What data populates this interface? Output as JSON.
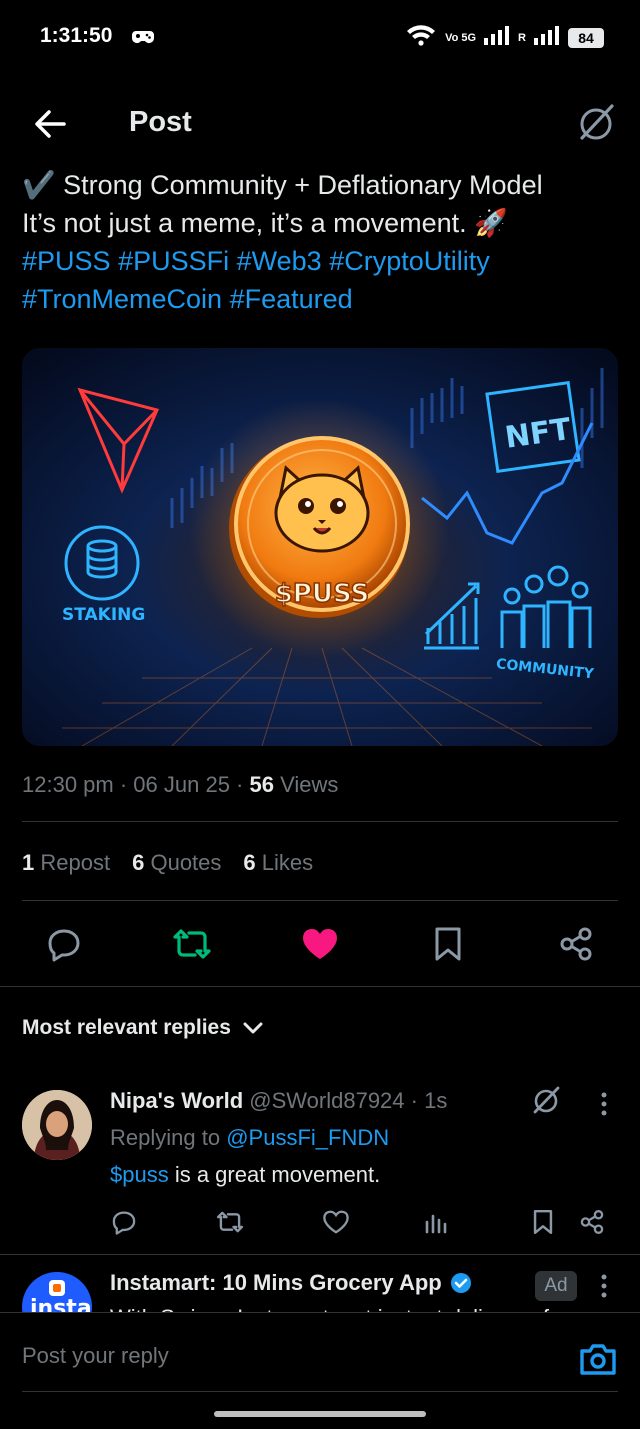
{
  "status_bar": {
    "time": "1:31:50",
    "network_label": "Vo 5G",
    "roaming_label": "R",
    "battery": "84"
  },
  "header": {
    "title": "Post"
  },
  "post": {
    "line1": "✔️ Strong Community + Deflationary Model",
    "line2": "It’s not just a meme, it’s a movement. 🚀",
    "hashtags_line1": [
      "#PUSS",
      "#PUSSFi",
      "#Web3",
      "#CryptoUtility"
    ],
    "hashtags_line2": [
      "#TronMemeCoin",
      "#Featured"
    ],
    "media": {
      "coin_label": "$PUSS",
      "staking_label": "STAKING",
      "nft_label": "NFT",
      "community_label": "COMMUNITY"
    },
    "time": "12:30 pm",
    "date": "06 Jun 25",
    "views_count": "56",
    "views_label": "Views",
    "reposts_count": "1",
    "reposts_label": "Repost",
    "quotes_count": "6",
    "quotes_label": "Quotes",
    "likes_count": "6",
    "likes_label": "Likes"
  },
  "colors": {
    "link": "#1d9bf0",
    "repost_active": "#00ba7c",
    "like_active": "#f91880",
    "muted": "#71767b"
  },
  "replies_filter": {
    "label": "Most relevant replies"
  },
  "reply": {
    "name": "Nipa's World",
    "handle": "@SWorld87924",
    "time": "1s",
    "replying_to_label": "Replying to",
    "replying_to_handle": "@PussFi_FNDN",
    "cashtag": "$puss",
    "text": " is a great movement."
  },
  "ad": {
    "name": "Instamart: 10 Mins Grocery App",
    "badge": "Ad",
    "avatar_text": "insta",
    "text": "With Swiggy Instamart, get instant delivery of"
  },
  "reply_bar": {
    "placeholder": "Post your reply"
  }
}
